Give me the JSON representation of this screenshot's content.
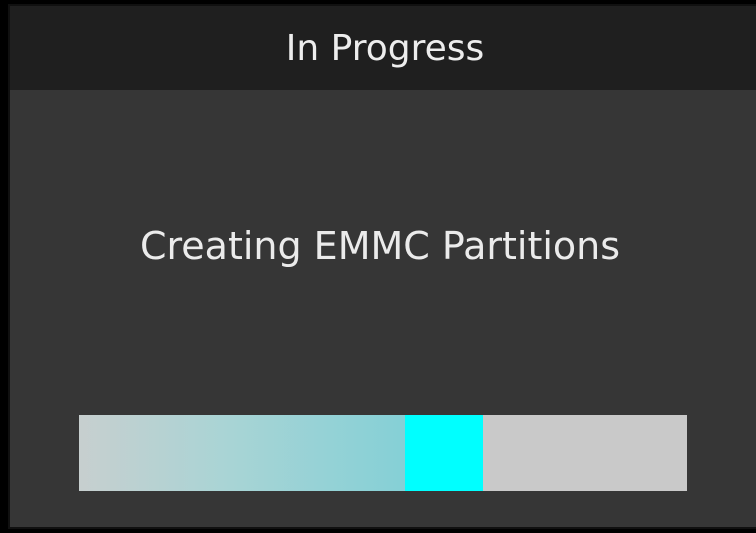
{
  "dialog": {
    "title": "In Progress",
    "message": "Creating EMMC Partitions"
  },
  "progress": {
    "trail_start": 0.0,
    "head_start": 0.537,
    "head_end": 0.664
  },
  "colors": {
    "titlebar_bg": "#1f1f1f",
    "body_bg": "#363636",
    "text": "#ebebeb",
    "track": "#c9c9c9",
    "indicator": "#00ffff"
  }
}
